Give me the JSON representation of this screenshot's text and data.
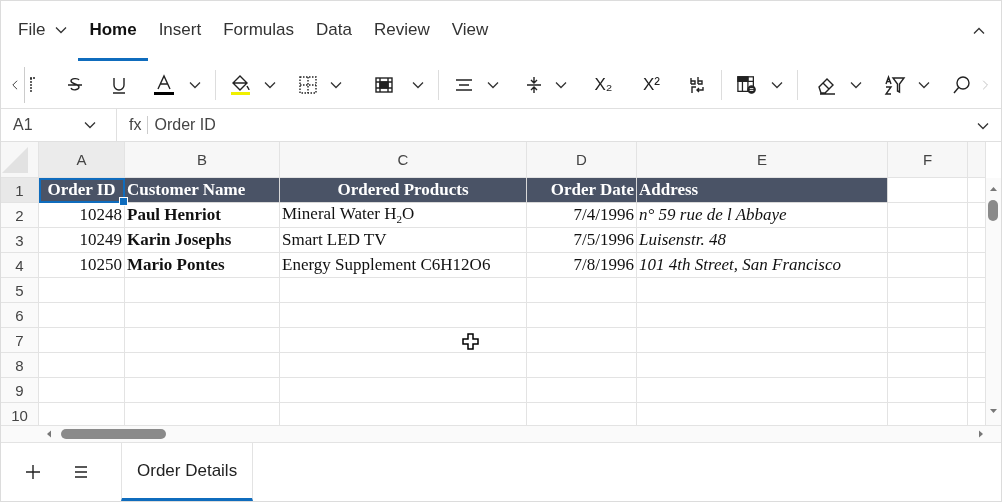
{
  "ribbon_tabs": [
    {
      "label": "File",
      "kind": "menu",
      "selected": false
    },
    {
      "label": "Home",
      "kind": "tab",
      "selected": true
    },
    {
      "label": "Insert",
      "kind": "tab",
      "selected": false
    },
    {
      "label": "Formulas",
      "kind": "tab",
      "selected": false
    },
    {
      "label": "Data",
      "kind": "tab",
      "selected": false
    },
    {
      "label": "Review",
      "kind": "tab",
      "selected": false
    },
    {
      "label": "View",
      "kind": "tab",
      "selected": false
    }
  ],
  "toolbar": {
    "subscript": "X₂",
    "superscript": "X²"
  },
  "formula_bar": {
    "name_box": "A1",
    "fx": "fx",
    "value": "Order ID"
  },
  "sheet": {
    "columns": [
      {
        "label": "A",
        "selected": true
      },
      {
        "label": "B",
        "selected": false
      },
      {
        "label": "C",
        "selected": false
      },
      {
        "label": "D",
        "selected": false
      },
      {
        "label": "E",
        "selected": false
      },
      {
        "label": "F",
        "selected": false
      }
    ],
    "rows": [
      {
        "number": "1",
        "selected": true,
        "cells": [
          {
            "text": "Order ID",
            "kind": "header",
            "selected": true
          },
          {
            "text": "Customer Name",
            "kind": "header",
            "selected": false
          },
          {
            "text": "Ordered Products",
            "kind": "header",
            "selected": false
          },
          {
            "text": "Order Date",
            "kind": "header",
            "selected": false
          },
          {
            "text": "Address",
            "kind": "header",
            "selected": false
          }
        ]
      },
      {
        "number": "2",
        "selected": false,
        "cells": [
          {
            "text": "10248",
            "kind": "number",
            "selected": false
          },
          {
            "text": "Paul Henriot",
            "kind": "bold",
            "selected": false
          },
          {
            "text": "Mineral Water H$_{2}$O",
            "kind": "plain",
            "selected": false
          },
          {
            "text": "7/4/1996",
            "kind": "date",
            "selected": false
          },
          {
            "text": "n° 59 rue de l Abbaye",
            "kind": "italic",
            "selected": false
          }
        ]
      },
      {
        "number": "3",
        "selected": false,
        "cells": [
          {
            "text": "10249",
            "kind": "number",
            "selected": false
          },
          {
            "text": "Karin Josephs",
            "kind": "bold",
            "selected": false
          },
          {
            "text": "Smart LED TV",
            "kind": "plain",
            "selected": false
          },
          {
            "text": "7/5/1996",
            "kind": "date",
            "selected": false
          },
          {
            "text": "Luisenstr. 48",
            "kind": "italic",
            "selected": false
          }
        ]
      },
      {
        "number": "4",
        "selected": false,
        "cells": [
          {
            "text": "10250",
            "kind": "number",
            "selected": false
          },
          {
            "text": "Mario Pontes",
            "kind": "bold",
            "selected": false
          },
          {
            "text": "Energy Supplement C6H12O6",
            "kind": "plain",
            "selected": false
          },
          {
            "text": "7/8/1996",
            "kind": "date",
            "selected": false
          },
          {
            "text": "101 4th Street, San Francisco",
            "kind": "italic",
            "selected": false
          }
        ]
      },
      {
        "number": "5",
        "selected": false
      },
      {
        "number": "6",
        "selected": false
      },
      {
        "number": "7",
        "selected": false
      },
      {
        "number": "8",
        "selected": false
      },
      {
        "number": "9",
        "selected": false
      },
      {
        "number": "10",
        "selected": false
      }
    ]
  },
  "sheet_tabs": [
    {
      "label": "Order Details",
      "selected": true
    }
  ]
}
